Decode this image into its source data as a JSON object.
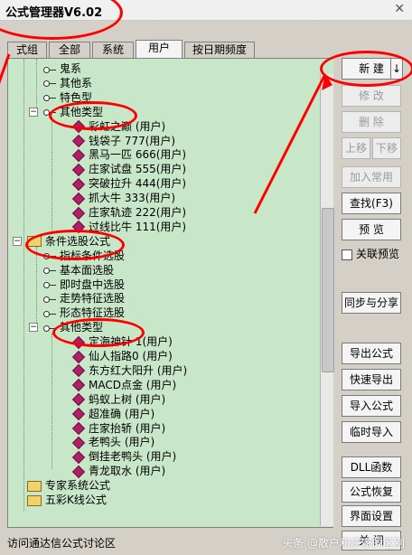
{
  "window": {
    "title": "公式管理器V6.02",
    "close_label": "✕"
  },
  "tabs": [
    {
      "label": "技术指标公式组",
      "display": "式组"
    },
    {
      "label": "全部"
    },
    {
      "label": "系统"
    },
    {
      "label": "用户"
    },
    {
      "label": "按日期频度"
    }
  ],
  "tree": [
    {
      "indent": 1,
      "icon": "key",
      "label": "鬼系"
    },
    {
      "indent": 1,
      "icon": "key",
      "label": "其他系"
    },
    {
      "indent": 1,
      "icon": "key",
      "label": "特色型"
    },
    {
      "indent": 1,
      "icon": "key",
      "expanded": true,
      "label": "其他类型"
    },
    {
      "indent": 2,
      "icon": "gem",
      "label": "彩虹之巅  (用户)"
    },
    {
      "indent": 2,
      "icon": "gem",
      "label": "钱袋子  777(用户)"
    },
    {
      "indent": 2,
      "icon": "gem",
      "label": "黑马一匹  666(用户)"
    },
    {
      "indent": 2,
      "icon": "gem",
      "label": "庄家试盘  555(用户)"
    },
    {
      "indent": 2,
      "icon": "gem",
      "label": "突破拉升  444(用户)"
    },
    {
      "indent": 2,
      "icon": "gem",
      "label": "抓大牛  333(用户)"
    },
    {
      "indent": 2,
      "icon": "gem",
      "label": "庄家轨迹  222(用户)"
    },
    {
      "indent": 2,
      "icon": "gem",
      "label": "过线比牛  111(用户)"
    },
    {
      "indent": 0,
      "icon": "folder",
      "expanded": true,
      "label": "条件选股公式"
    },
    {
      "indent": 1,
      "icon": "key",
      "label": "指标条件选股"
    },
    {
      "indent": 1,
      "icon": "key",
      "label": "基本面选股"
    },
    {
      "indent": 1,
      "icon": "key",
      "label": "即时盘中选股"
    },
    {
      "indent": 1,
      "icon": "key",
      "label": "走势特征选股"
    },
    {
      "indent": 1,
      "icon": "key",
      "label": "形态特征选股"
    },
    {
      "indent": 1,
      "icon": "key",
      "expanded": true,
      "label": "其他类型"
    },
    {
      "indent": 2,
      "icon": "gem",
      "label": "定海神针  1(用户)"
    },
    {
      "indent": 2,
      "icon": "gem",
      "label": "仙人指路0  (用户)"
    },
    {
      "indent": 2,
      "icon": "gem",
      "label": "东方红大阳升  (用户)"
    },
    {
      "indent": 2,
      "icon": "gem",
      "label": "MACD点金  (用户)"
    },
    {
      "indent": 2,
      "icon": "gem",
      "label": "蚂蚁上树  (用户)"
    },
    {
      "indent": 2,
      "icon": "gem",
      "label": "超准确  (用户)"
    },
    {
      "indent": 2,
      "icon": "gem",
      "label": "庄家抬轿  (用户)"
    },
    {
      "indent": 2,
      "icon": "gem",
      "label": "老鸭头  (用户)"
    },
    {
      "indent": 2,
      "icon": "gem",
      "label": "倒挂老鸭头  (用户)"
    },
    {
      "indent": 2,
      "icon": "gem",
      "label": "青龙取水  (用户)"
    },
    {
      "indent": 0,
      "icon": "folder",
      "label": "专家系统公式"
    },
    {
      "indent": 0,
      "icon": "folder",
      "label": "五彩K线公式"
    }
  ],
  "buttons": {
    "new": "新 建",
    "modify": "修 改",
    "delete": "删 除",
    "move_up": "上移",
    "move_down": "下移",
    "add_common": "加入常用",
    "find": "查找(F3)",
    "preview": "预 览",
    "link_preview": "关联预览",
    "sync_share": "同步与分享",
    "export": "导出公式",
    "quick_export": "快速导出",
    "import": "导入公式",
    "temp_import": "临时导入",
    "dll": "DLL函数",
    "restore": "公式恢复",
    "ui_settings": "界面设置",
    "close": "关 闭",
    "new_arrow": "↓"
  },
  "footer": {
    "link": "访问通达信公式讨论区",
    "watermark": "头条 @散户和庄家的区别"
  },
  "colors": {
    "tree_bg": "#c8e6c8",
    "annotation": "#ff0000"
  }
}
